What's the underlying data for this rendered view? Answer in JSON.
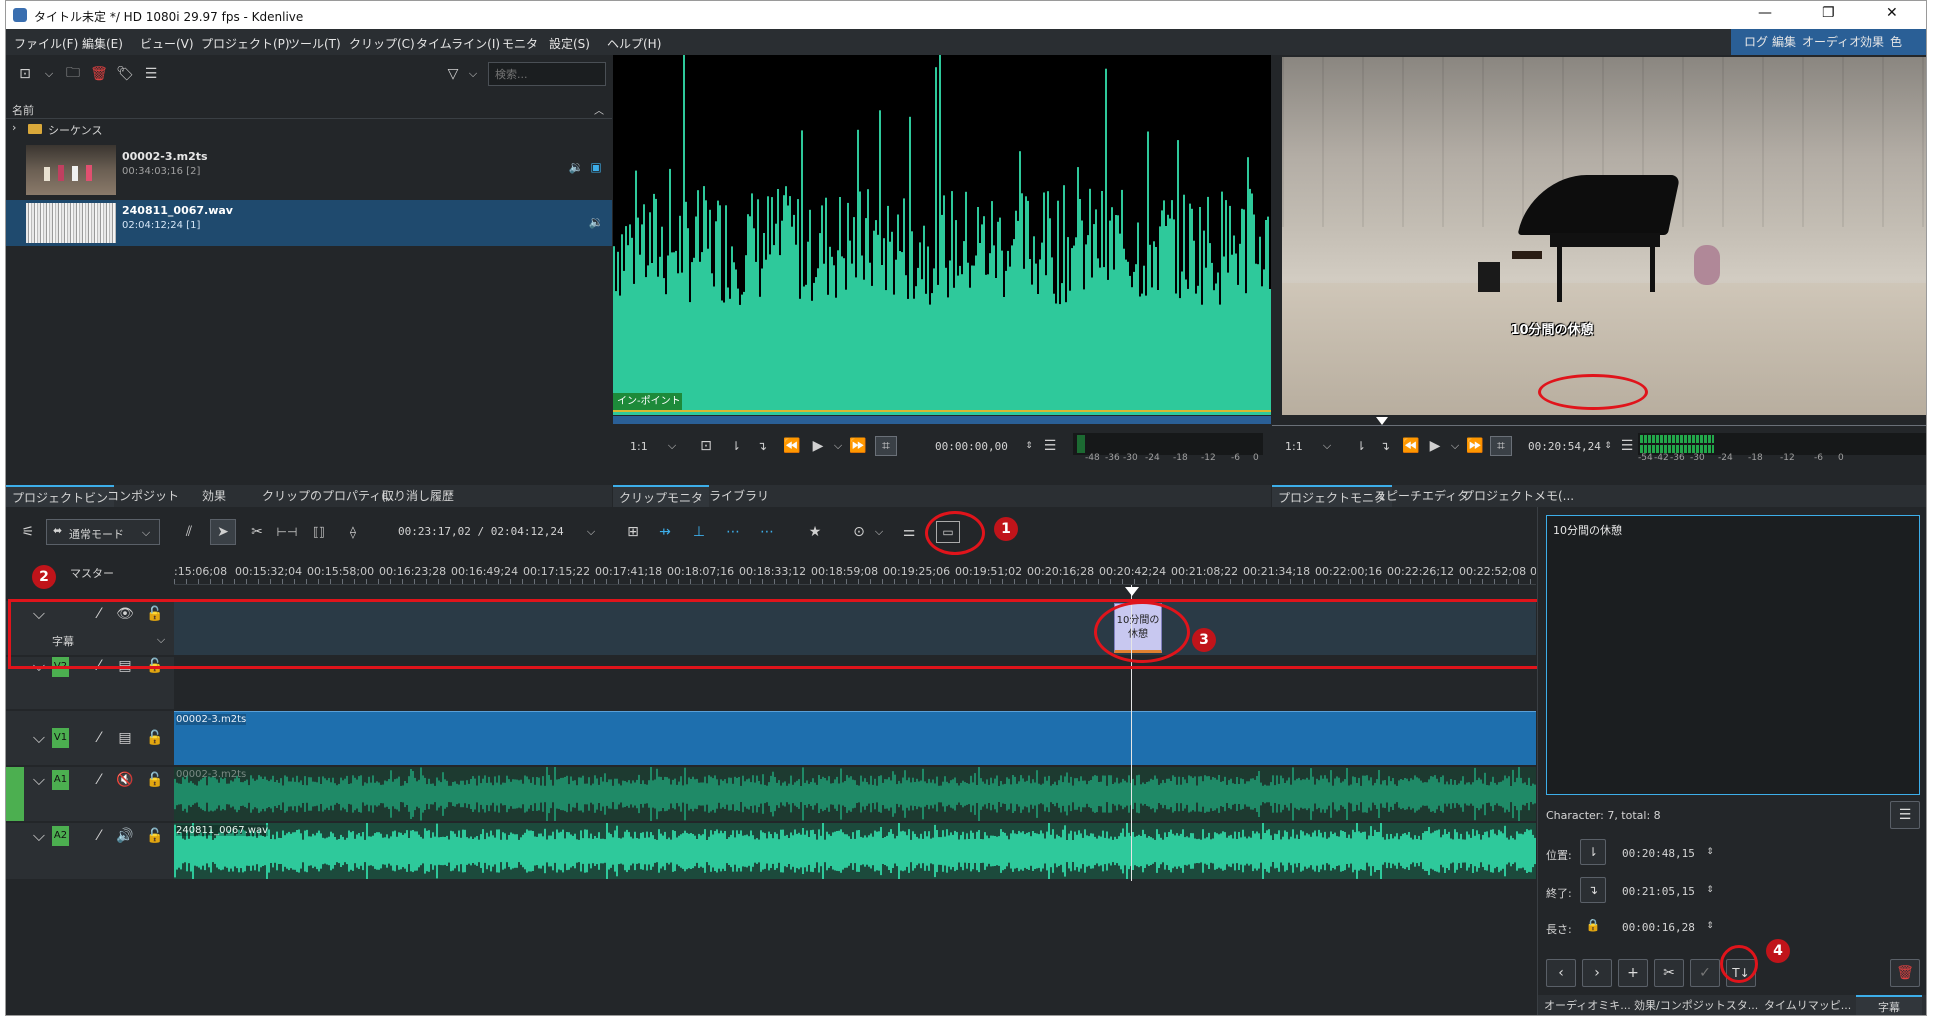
{
  "window": {
    "title": "タイトル未定 */ HD 1080i 29.97 fps - Kdenlive",
    "min": "—",
    "restore": "❐",
    "close": "✕"
  },
  "menu": [
    "ファイル(F)",
    "編集(E)",
    "ビュー(V)",
    "プロジェクト(P)",
    "ツール(T)",
    "クリップ(C)",
    "タイムライン(I)",
    "モニタ",
    "設定(S)",
    "ヘルプ(H)"
  ],
  "layouts": [
    "ログ",
    "編集",
    "オーディオ",
    "効果",
    "色"
  ],
  "bin": {
    "search_placeholder": "検索...",
    "column_name": "名前",
    "folder": "シーケンス",
    "clips": [
      {
        "name": "00002-3.m2ts",
        "info": "00:34:03;16 [2]"
      },
      {
        "name": "240811_0067.wav",
        "info": "02:04:12;24 [1]"
      }
    ],
    "tabs": [
      "プロジェクトビン",
      "コンポジット",
      "効果",
      "クリップのプロパティ(...",
      "取り消し履歴"
    ]
  },
  "clip_monitor": {
    "inpoint_label": "イン-ポイント",
    "zoom": "1:1",
    "timecode": "00:00:00,00",
    "meter_labels": [
      "-48",
      "-36",
      "-30",
      "-24",
      "-18",
      "-12",
      "-6",
      "0"
    ],
    "tabs": [
      "クリップモニタ",
      "ライブラリ"
    ]
  },
  "project_monitor": {
    "subtitle_text": "10分間の休憩",
    "zoom": "1:1",
    "timecode": "00:20:54,24",
    "meter_labels": [
      "-54",
      "-42",
      "-36",
      "-30",
      "-24",
      "-18",
      "-12",
      "-6",
      "0"
    ],
    "tabs": [
      "プロジェクトモニタ",
      "スピーチエディタ",
      "プロジェクトメモ(..."
    ]
  },
  "timeline": {
    "mode": "通常モード",
    "position": "00:23:17,02 / 02:04:12,24",
    "master_label": "マスター",
    "ruler": [
      ":15:06;08",
      "00:15:32;04",
      "00:15:58;00",
      "00:16:23;28",
      "00:16:49;24",
      "00:17:15;22",
      "00:17:41;18",
      "00:18:07;16",
      "00:18:33;12",
      "00:18:59;08",
      "00:19:25;06",
      "00:19:51;02",
      "00:20:16;28",
      "00:20:42;24",
      "00:21:08;22",
      "00:21:34;18",
      "00:22:00;16",
      "00:22:26;12",
      "00:22:52;08",
      "0"
    ],
    "subtitle_track_label": "字幕",
    "subtitle_clip": "10分間の休憩",
    "tracks": [
      {
        "badge": "V2"
      },
      {
        "badge": "V1",
        "clip": "00002-3.m2ts"
      },
      {
        "badge": "A1",
        "clip": "00002-3.m2ts"
      },
      {
        "badge": "A2",
        "clip": "240811_0067.wav"
      }
    ]
  },
  "subtitle_editor": {
    "text": "10分間の休憩",
    "char_count": "Character: 7, total: 8",
    "pos_label": "位置:",
    "pos_value": "00:20:48,15",
    "end_label": "終了:",
    "end_value": "00:21:05,15",
    "dur_label": "長さ:",
    "dur_value": "00:00:16,28",
    "tabs": [
      "オーディオミキ...",
      "効果/コンポジットスタ...",
      "タイムリマッピ...",
      "字幕"
    ]
  },
  "annotations": [
    "1",
    "2",
    "3",
    "4"
  ],
  "colors": {
    "accent": "#3daee9",
    "waveform": "#2ec99b",
    "video_clip": "#1e6fae",
    "subtitle_clip": "#c8c8f0",
    "annotation": "#e0141b",
    "track_badge": "#4caf50"
  }
}
